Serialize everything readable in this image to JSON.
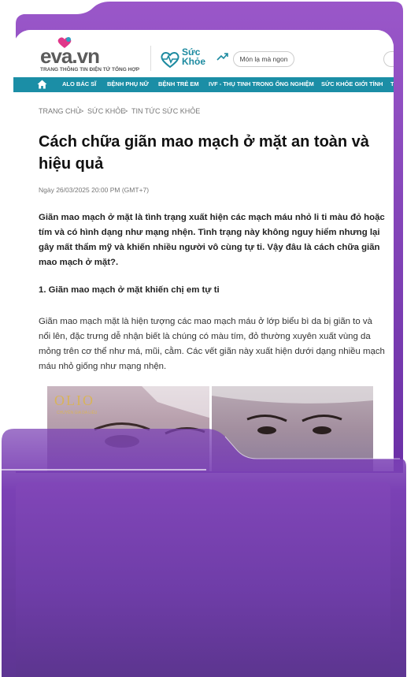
{
  "header": {
    "logo_text": "eva.vn",
    "logo_tagline": "TRANG THÔNG TIN ĐIỆN TỬ TỔNG HỢP",
    "section_name_line1": "Sức",
    "section_name_line2": "Khỏe",
    "search_label": "Món lạ mà ngon"
  },
  "nav": {
    "items": [
      "ALO BÁC SĨ",
      "BỆNH PHỤ NỮ",
      "BỆNH TRẺ EM",
      "IVF - THỤ TINH TRONG ỐNG NGHIỆM",
      "SỨC KHỎE GIỚI TÍNH",
      "T"
    ]
  },
  "breadcrumb": {
    "home": "TRANG CHỦ",
    "section": "SỨC KHỎE",
    "sub": "TIN TỨC SỨC KHỎE",
    "sep": ">"
  },
  "article": {
    "title": "Cách chữa giãn mao mạch ở mặt an toàn và hiệu quả",
    "date": "Ngày 26/03/2025 20:00 PM (GMT+7)",
    "lead": "Giãn mao mạch ở mặt là tình trạng xuất hiện các mạch máu nhỏ li ti màu đỏ hoặc tím và có hình dạng như mạng nhện. Tình trạng này không nguy hiểm nhưng lại gây mất thẩm mỹ và khiến nhiều người vô cùng tự ti. Vậy đâu là cách chữa giãn mao mạch ở mặt?.",
    "heading1": "1. Giãn mao mạch ở mặt khiến chị em tự ti",
    "paragraph1": "Giãn mao mạch mặt là hiện tượng các mao mạch máu ở lớp biểu bì da bị giãn to và nổi lên, đặc trưng dễ nhận biết là chúng có màu tím, đỏ thường xuyên xuất vùng da mỏng trên cơ thể như má, mũi, cằm. Các vết giãn này xuất hiện dưới dạng nhiều mạch máu nhỏ giống như mạng nhện.",
    "image_brand": "OLIO",
    "image_brand_sub": "CHUYÊN GIA DA LIỄU"
  },
  "colors": {
    "purple_frame": "#7e43b9",
    "nav_teal": "#1b8ea6",
    "brand_teal": "#1c8aa0"
  }
}
